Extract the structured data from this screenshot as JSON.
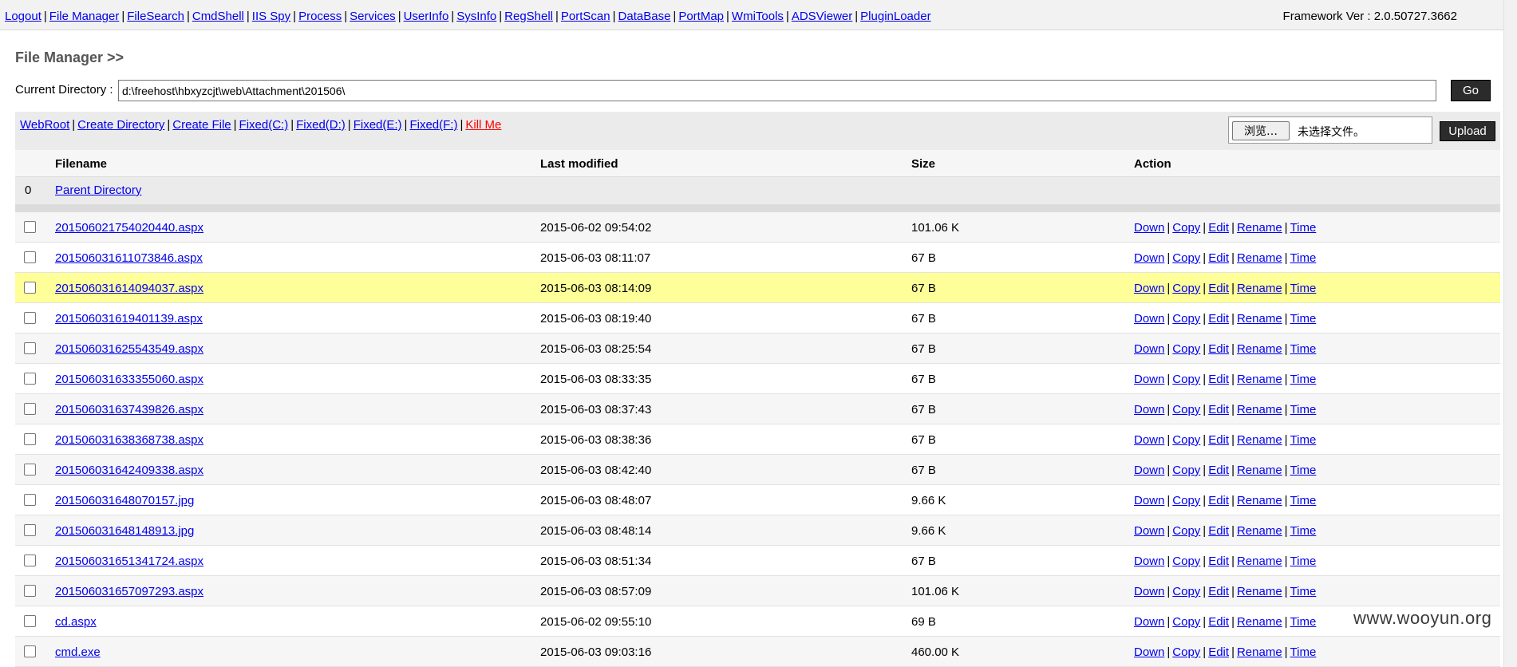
{
  "nav": {
    "links": [
      "Logout",
      "File Manager",
      "FileSearch",
      "CmdShell",
      "IIS Spy",
      "Process",
      "Services",
      "UserInfo",
      "SysInfo",
      "RegShell",
      "PortScan",
      "DataBase",
      "PortMap",
      "WmiTools",
      "ADSViewer",
      "PluginLoader"
    ],
    "framework": "Framework Ver : 2.0.50727.3662"
  },
  "page": {
    "title": "File Manager >>",
    "current_dir_label": "Current Directory :",
    "current_dir_value": "d:\\freehost\\hbxyzcjt\\web\\Attachment\\201506\\",
    "go_label": "Go"
  },
  "toolbar": {
    "links": [
      "WebRoot",
      "Create Directory",
      "Create File",
      "Fixed(C:)",
      "Fixed(D:)",
      "Fixed(E:)",
      "Fixed(F:)"
    ],
    "kill_label": "Kill Me",
    "browse_label": "浏览…",
    "no_file_label": "未选择文件。",
    "upload_label": "Upload"
  },
  "table": {
    "headers": {
      "filename": "Filename",
      "modified": "Last modified",
      "size": "Size",
      "action": "Action"
    },
    "parent": {
      "index": "0",
      "label": "Parent Directory"
    },
    "actions": [
      "Down",
      "Copy",
      "Edit",
      "Rename",
      "Time"
    ],
    "rows": [
      {
        "name": "201506021754020440.aspx",
        "modified": "2015-06-02 09:54:02",
        "size": "101.06 K"
      },
      {
        "name": "201506031611073846.aspx",
        "modified": "2015-06-03 08:11:07",
        "size": "67 B"
      },
      {
        "name": "201506031614094037.aspx",
        "modified": "2015-06-03 08:14:09",
        "size": "67 B"
      },
      {
        "name": "201506031619401139.aspx",
        "modified": "2015-06-03 08:19:40",
        "size": "67 B"
      },
      {
        "name": "201506031625543549.aspx",
        "modified": "2015-06-03 08:25:54",
        "size": "67 B"
      },
      {
        "name": "201506031633355060.aspx",
        "modified": "2015-06-03 08:33:35",
        "size": "67 B"
      },
      {
        "name": "201506031637439826.aspx",
        "modified": "2015-06-03 08:37:43",
        "size": "67 B"
      },
      {
        "name": "201506031638368738.aspx",
        "modified": "2015-06-03 08:38:36",
        "size": "67 B"
      },
      {
        "name": "201506031642409338.aspx",
        "modified": "2015-06-03 08:42:40",
        "size": "67 B"
      },
      {
        "name": "201506031648070157.jpg",
        "modified": "2015-06-03 08:48:07",
        "size": "9.66 K"
      },
      {
        "name": "201506031648148913.jpg",
        "modified": "2015-06-03 08:48:14",
        "size": "9.66 K"
      },
      {
        "name": "201506031651341724.aspx",
        "modified": "2015-06-03 08:51:34",
        "size": "67 B"
      },
      {
        "name": "201506031657097293.aspx",
        "modified": "2015-06-03 08:57:09",
        "size": "101.06 K"
      },
      {
        "name": "cd.aspx",
        "modified": "2015-06-02 09:55:10",
        "size": "69 B"
      },
      {
        "name": "cmd.exe",
        "modified": "2015-06-03 09:03:16",
        "size": "460.00 K"
      }
    ],
    "highlight_row": 2
  },
  "watermark": "www.wooyun.org"
}
